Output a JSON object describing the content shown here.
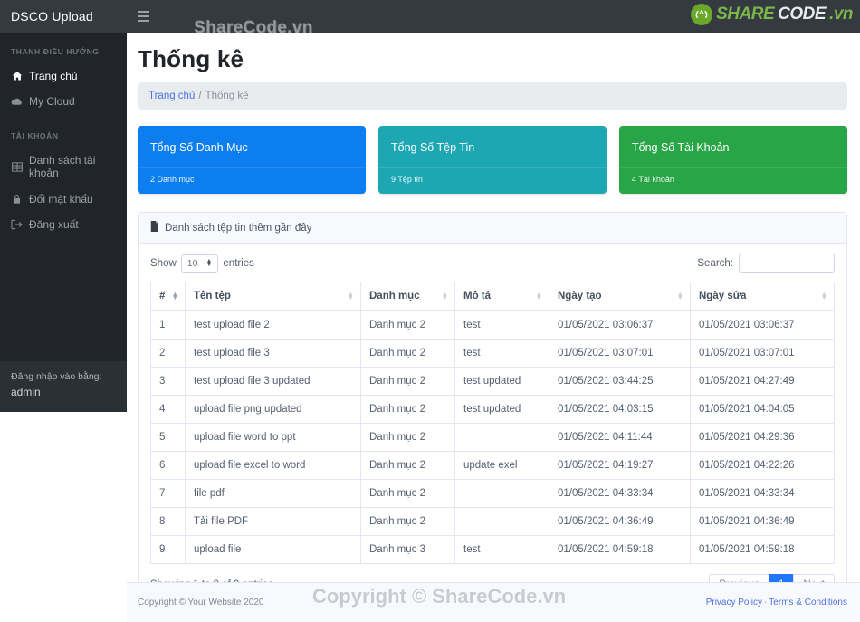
{
  "topbar": {
    "brand": "DSCO Upload",
    "menu_icon": "hamburger-icon",
    "watermark": "ShareCode.vn",
    "logo": {
      "share": "SHARE",
      "code": "CODE",
      "vn": ".vn"
    }
  },
  "sidebar": {
    "nav_heading": "THANH ĐIỀU HƯỚNG",
    "account_heading": "TÀI KHOẢN",
    "nav_items": [
      {
        "label": "Trang chủ",
        "icon": "home-icon",
        "active": true
      },
      {
        "label": "My Cloud",
        "icon": "cloud-icon",
        "active": false
      }
    ],
    "account_items": [
      {
        "label": "Danh sách tài khoản",
        "icon": "table-icon"
      },
      {
        "label": "Đổi mật khẩu",
        "icon": "lock-icon"
      },
      {
        "label": "Đăng xuất",
        "icon": "sign-out-icon"
      }
    ],
    "login_label": "Đăng nhập vào bằng:",
    "login_user": "admin"
  },
  "page": {
    "title": "Thống kê",
    "breadcrumb_home": "Trang chủ",
    "breadcrumb_sep": "/",
    "breadcrumb_current": "Thống kê"
  },
  "cards": [
    {
      "title": "Tổng Số Danh Mục",
      "sub": "2 Danh mục",
      "color": "#0d7ef0"
    },
    {
      "title": "Tổng Số Tệp Tin",
      "sub": "9 Tệp tin",
      "color": "#1ca7b3"
    },
    {
      "title": "Tổng Số Tài Khoản",
      "sub": "4 Tài khoản",
      "color": "#28a546"
    }
  ],
  "panel": {
    "heading": "Danh sách tệp tin thêm gần đây",
    "heading_icon": "file-icon"
  },
  "datatable": {
    "show_label": "Show",
    "length_value": "10",
    "entries_label": "entries",
    "search_label": "Search:",
    "search_value": "",
    "search_placeholder": "",
    "columns": [
      "#",
      "Tên tệp",
      "Danh mục",
      "Mô tả",
      "Ngày tạo",
      "Ngày sửa"
    ],
    "rows": [
      [
        "1",
        "test upload file 2",
        "Danh mục 2",
        "test",
        "01/05/2021 03:06:37",
        "01/05/2021 03:06:37"
      ],
      [
        "2",
        "test upload file 3",
        "Danh mục 2",
        "test",
        "01/05/2021 03:07:01",
        "01/05/2021 03:07:01"
      ],
      [
        "3",
        "test upload file 3 updated",
        "Danh mục 2",
        "test updated",
        "01/05/2021 03:44:25",
        "01/05/2021 04:27:49"
      ],
      [
        "4",
        "upload file png updated",
        "Danh mục 2",
        "test updated",
        "01/05/2021 04:03:15",
        "01/05/2021 04:04:05"
      ],
      [
        "5",
        "upload file word to ppt",
        "Danh mục 2",
        "",
        "01/05/2021 04:11:44",
        "01/05/2021 04:29:36"
      ],
      [
        "6",
        "upload file excel to word",
        "Danh mục 2",
        "update exel",
        "01/05/2021 04:19:27",
        "01/05/2021 04:22:26"
      ],
      [
        "7",
        "file pdf",
        "Danh mục 2",
        "",
        "01/05/2021 04:33:34",
        "01/05/2021 04:33:34"
      ],
      [
        "8",
        "Tải file PDF",
        "Danh mục 2",
        "",
        "01/05/2021 04:36:49",
        "01/05/2021 04:36:49"
      ],
      [
        "9",
        "upload file",
        "Danh mục 3",
        "test",
        "01/05/2021 04:59:18",
        "01/05/2021 04:59:18"
      ]
    ],
    "info": "Showing 1 to 9 of 9 entries",
    "pagination": {
      "previous": "Previous",
      "page": "1",
      "next": "Next"
    }
  },
  "footer": {
    "copyright": "Copyright © Your Website 2020",
    "privacy": "Privacy Policy",
    "dot": "·",
    "terms": "Terms & Conditions",
    "watermark": "Copyright © ShareCode.vn"
  }
}
